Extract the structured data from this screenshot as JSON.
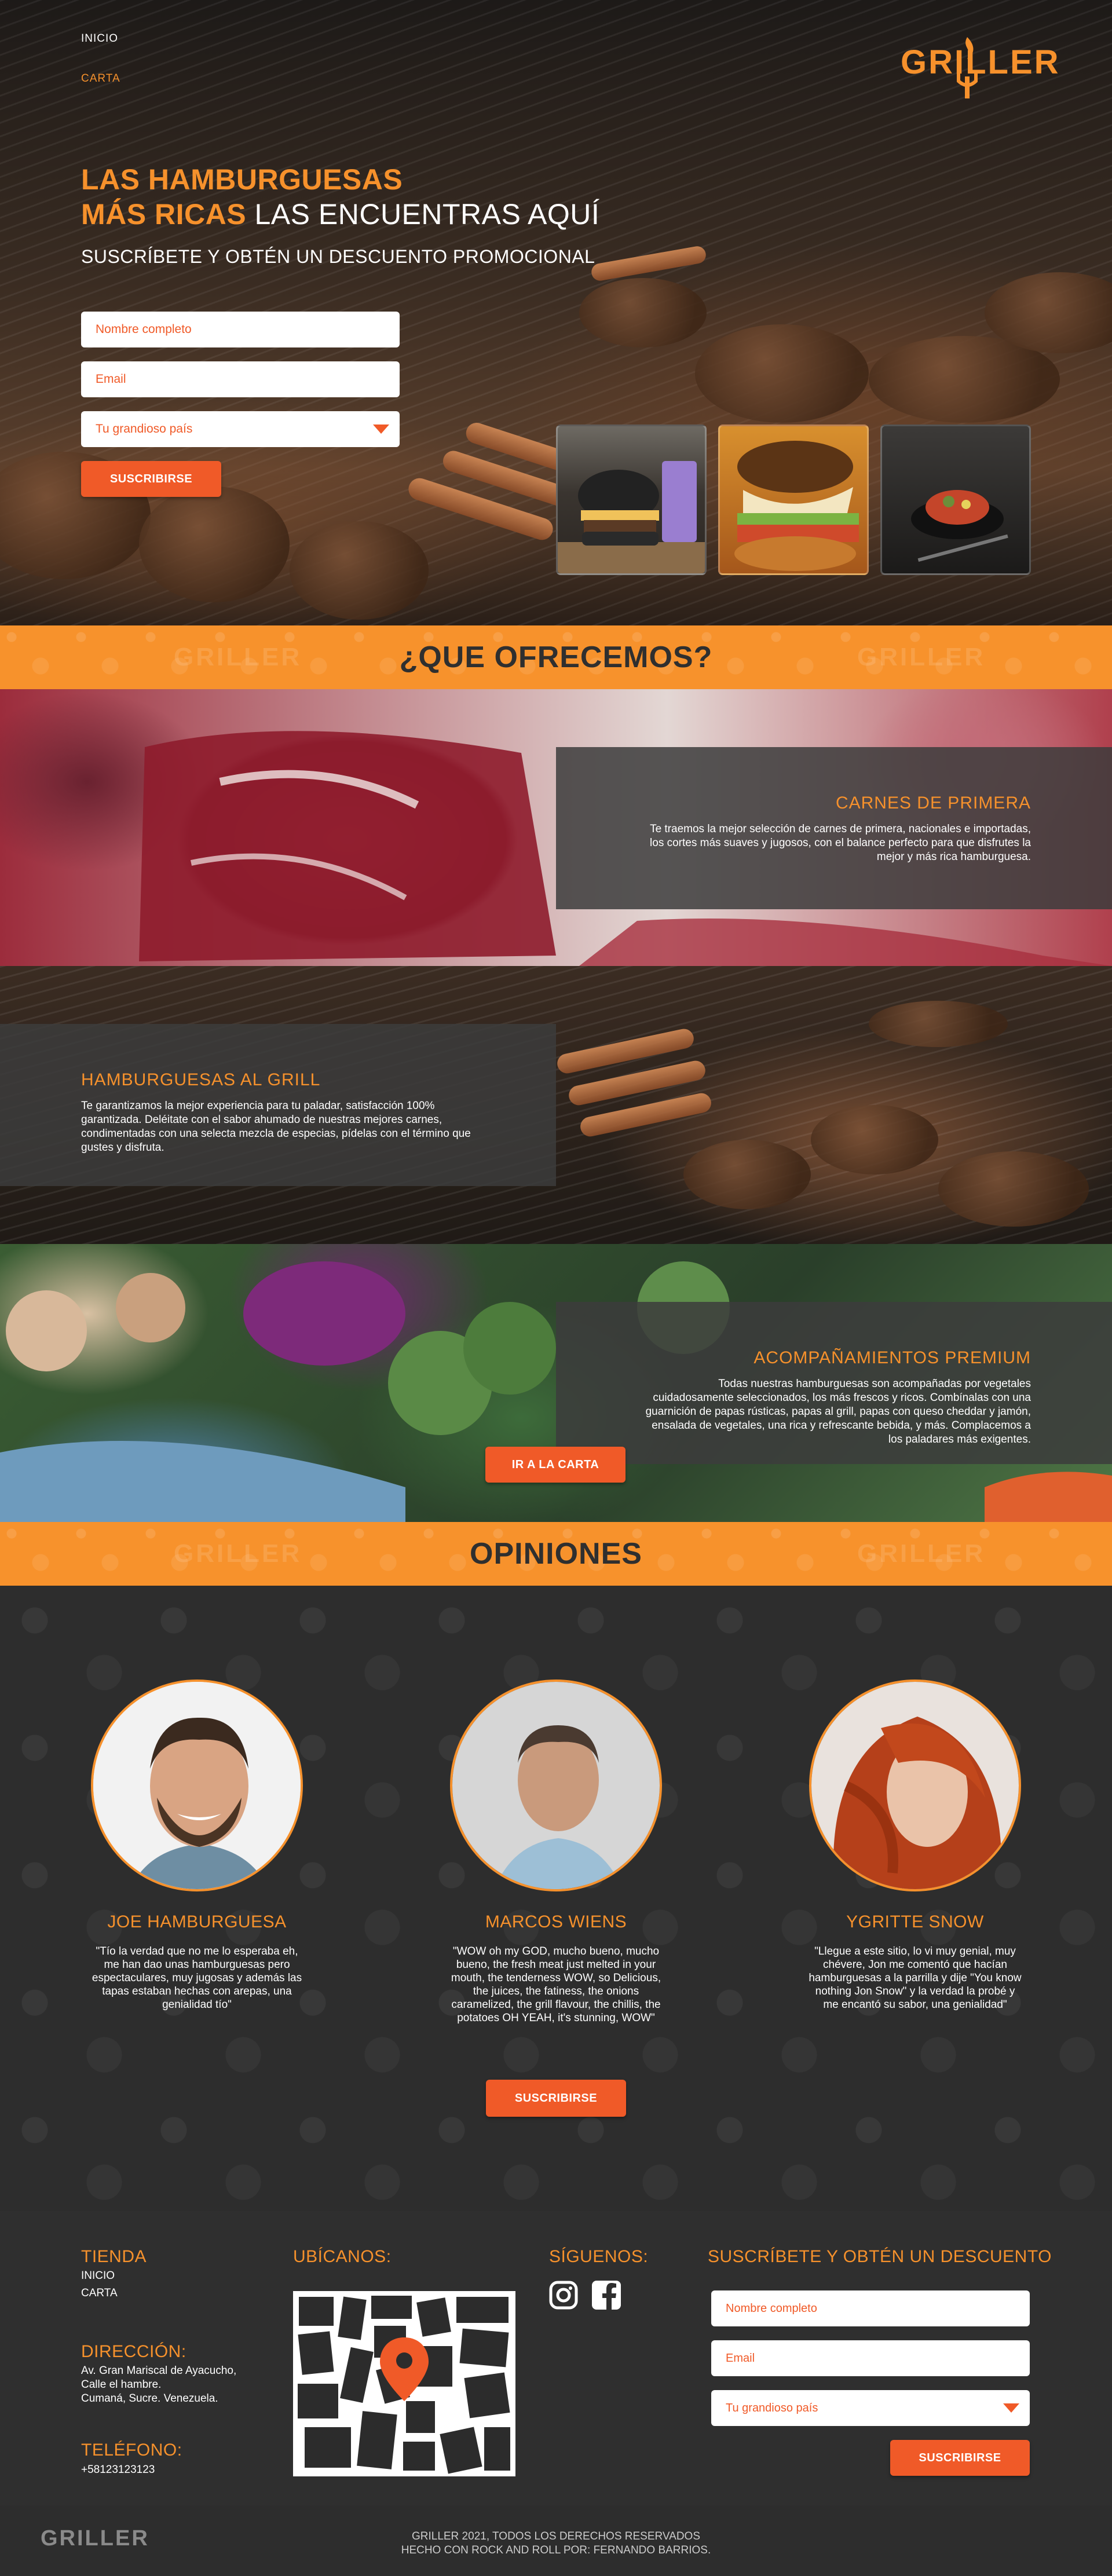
{
  "nav": {
    "home": "INICIO",
    "menu": "CARTA"
  },
  "brand": {
    "logo": "GRILLER"
  },
  "hero": {
    "title_line1": "LAS HAMBURGUESAS",
    "title_line2_orange": "MÁS RICAS",
    "title_line2_white": "LAS ENCUENTRAS AQUÍ",
    "subtitle": "SUSCRÍBETE Y OBTÉN UN DESCUENTO PROMOCIONAL",
    "form": {
      "name_placeholder": "Nombre completo",
      "email_placeholder": "Email",
      "country_selected": "Tu grandioso país",
      "submit": "SUSCRIBIRSE"
    }
  },
  "offers": {
    "heading": "¿QUE OFRECEMOS?",
    "items": [
      {
        "title": "CARNES DE PRIMERA",
        "text": "Te traemos la mejor selección de carnes de primera, nacionales e importadas, los cortes más suaves y jugosos, con el balance perfecto para que disfrutes la mejor y más rica hamburguesa."
      },
      {
        "title": "HAMBURGUESAS AL GRILL",
        "text": "Te garantizamos la mejor experiencia para tu paladar, satisfacción 100% garantizada. Deléitate con el sabor ahumado de nuestras mejores carnes, condimentadas con una selecta mezcla de especias, pídelas con el término que gustes y disfruta."
      },
      {
        "title": "ACOMPAÑAMIENTOS PREMIUM",
        "text": "Todas nuestras hamburguesas son acompañadas por vegetales cuidadosamente seleccionados, los más frescos y ricos. Combínalas con una guarnición de papas rústicas, papas al grill, papas con queso cheddar y jamón, ensalada de vegetales, una rica y refrescante bebida, y más. Complacemos a los paladares más exigentes."
      }
    ],
    "menu_button": "IR A LA CARTA"
  },
  "opinions": {
    "heading": "OPINIONES",
    "items": [
      {
        "name": "JOE HAMBURGUESA",
        "text": "\"Tío la verdad que no me lo esperaba eh, me han dao unas hamburguesas pero espectaculares, muy jugosas y además las tapas estaban hechas con arepas, una genialidad tío\""
      },
      {
        "name": "MARCOS WIENS",
        "text": "\"WOW oh my GOD, mucho bueno, mucho bueno, the fresh meat just melted in your mouth, the tenderness WOW, so Delicious, the juices, the fatiness, the onions caramelized, the grill flavour, the chillis, the potatoes OH YEAH, it's stunning, WOW\""
      },
      {
        "name": "YGRITTE SNOW",
        "text": "\"Llegue a este sitio, lo vi muy genial, muy chévere, Jon me comentó que hacían hamburguesas a la parrilla y dije \"You know nothing Jon Snow\" y la verdad la probé y me encantó su sabor, una genialidad\""
      }
    ],
    "subscribe_button": "SUSCRIBIRSE"
  },
  "footer": {
    "store_heading": "TIENDA",
    "store_links": [
      "INICIO",
      "CARTA"
    ],
    "address_heading": "DIRECCIÓN:",
    "address_lines": [
      "Av. Gran Mariscal de Ayacucho,",
      "Calle el hambre.",
      "Cumaná, Sucre. Venezuela."
    ],
    "phone_heading": "TELÉFONO:",
    "phone": "+58123123123",
    "location_heading": "UBÍCANOS:",
    "follow_heading": "SÍGUENOS:",
    "subscribe_heading": "SUSCRÍBETE Y OBTÉN UN DESCUENTO",
    "form": {
      "name_placeholder": "Nombre completo",
      "email_placeholder": "Email",
      "country_selected": "Tu grandioso país",
      "submit": "SUSCRIBIRSE"
    },
    "copyright_line1": "GRILLER 2021, TODOS LOS DERECHOS RESERVADOS",
    "copyright_line2": "HECHO CON ROCK AND ROLL POR: FERNANDO BARRIOS.",
    "logo": "GRILLER"
  },
  "icons": [
    "flame-fork-logo-icon",
    "chevron-down-icon",
    "map-pin-icon",
    "instagram-icon",
    "facebook-icon"
  ],
  "colors": {
    "accent": "#f6912c",
    "button": "#f05a28",
    "dark": "#2c2c2c"
  }
}
